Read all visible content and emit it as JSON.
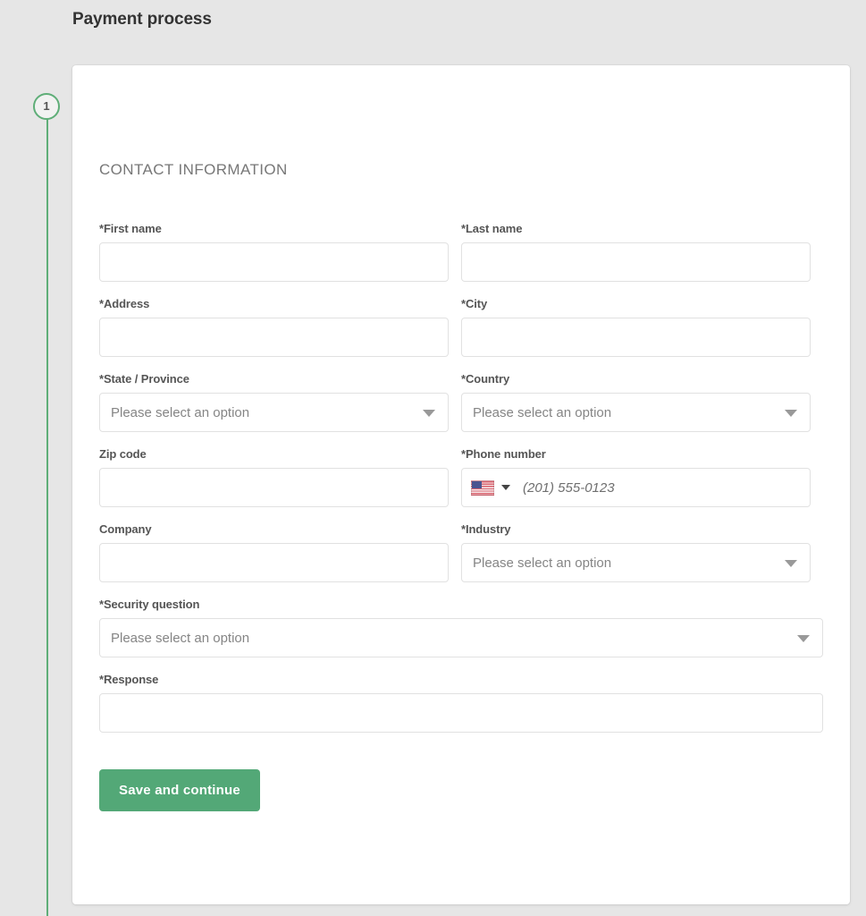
{
  "page": {
    "title": "Payment process",
    "background_color": "#e6e6e6"
  },
  "stepper": {
    "accent_color": "#5fae78",
    "current_step": "1"
  },
  "card": {
    "section_heading": "CONTACT INFORMATION"
  },
  "form": {
    "select_placeholder": "Please select an option",
    "rows": [
      {
        "fields": [
          {
            "label": "*First name",
            "type": "text",
            "value": "",
            "placeholder": ""
          },
          {
            "label": "*Last name",
            "type": "text",
            "value": "",
            "placeholder": ""
          }
        ]
      },
      {
        "fields": [
          {
            "label": "*Address",
            "type": "text",
            "value": "",
            "placeholder": ""
          },
          {
            "label": "*City",
            "type": "text",
            "value": "",
            "placeholder": ""
          }
        ]
      },
      {
        "fields": [
          {
            "label": "*State / Province",
            "type": "select",
            "value": "Please select an option"
          },
          {
            "label": "*Country",
            "type": "select",
            "value": "Please select an option"
          }
        ]
      },
      {
        "fields": [
          {
            "label": "Zip code",
            "type": "text",
            "value": "",
            "placeholder": ""
          },
          {
            "label": "*Phone number",
            "type": "phone",
            "value": "",
            "placeholder": "(201) 555-0123",
            "country_flag": "us-flag-icon"
          }
        ]
      },
      {
        "fields": [
          {
            "label": "Company",
            "type": "text",
            "value": "",
            "placeholder": ""
          },
          {
            "label": "*Industry",
            "type": "select",
            "value": "Please select an option"
          }
        ]
      }
    ],
    "full_rows": [
      {
        "label": "*Security question",
        "type": "select",
        "value": "Please select an option"
      },
      {
        "label": "*Response",
        "type": "text",
        "value": "",
        "placeholder": ""
      }
    ],
    "submit_label": "Save and continue",
    "submit_color": "#53a877"
  }
}
